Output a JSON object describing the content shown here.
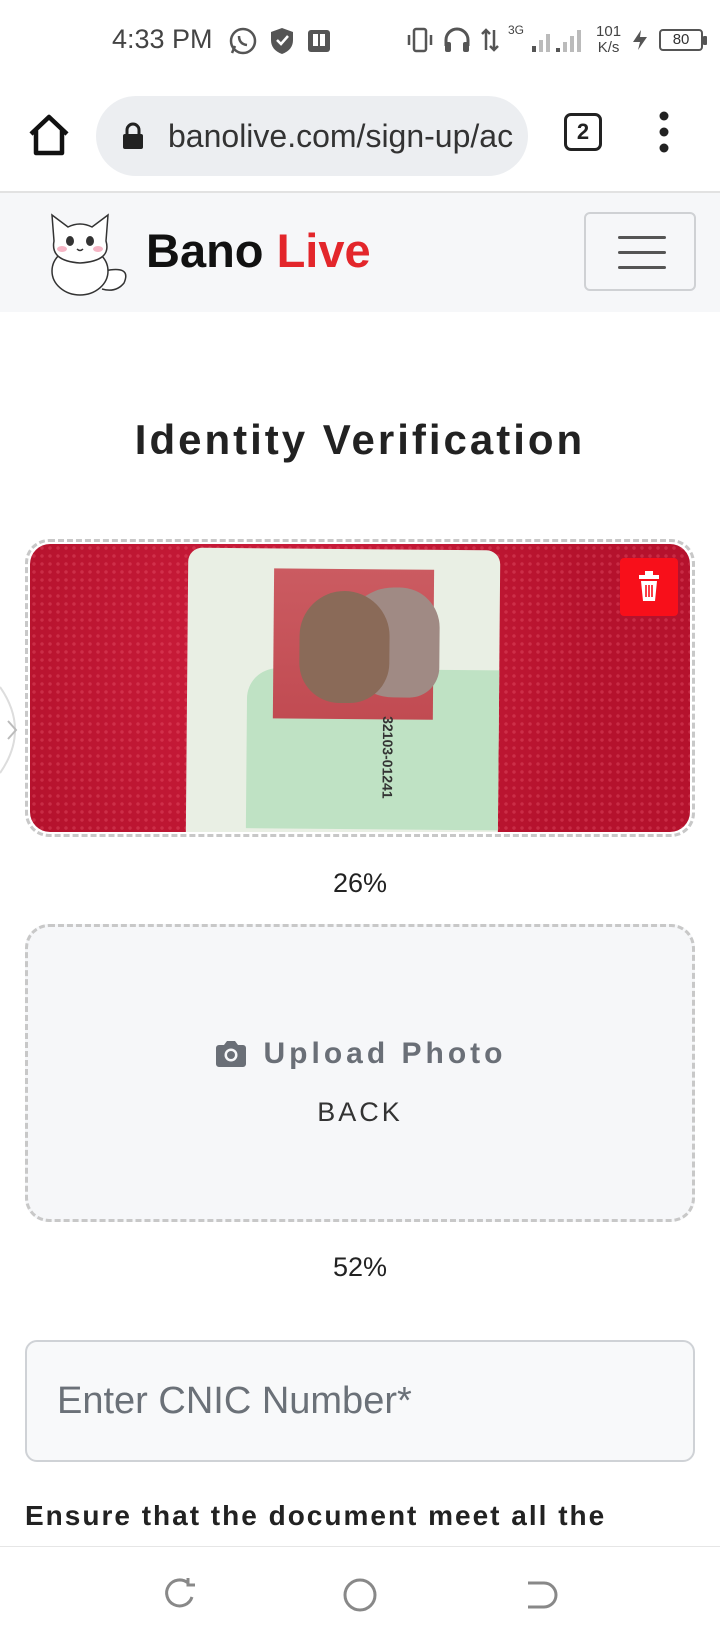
{
  "status_bar": {
    "time": "4:33 PM",
    "network_gen": "3G",
    "net_speed_value": "101",
    "net_speed_unit": "K/s",
    "battery": "80"
  },
  "browser": {
    "url": "banolive.com/sign-up/ac",
    "tab_count": "2"
  },
  "site": {
    "brand_part1": "Bano",
    "brand_part2": "Live",
    "accent_color": "#e3262b"
  },
  "page": {
    "title": "Identity Verification",
    "front_upload": {
      "progress_text": "26%",
      "progress": 0.26
    },
    "back_upload": {
      "label": "Upload Photo",
      "side": "BACK",
      "progress_text": "52%",
      "progress": 0.52
    },
    "cnic_placeholder": "Enter CNIC Number*",
    "note": "Ensure that the document meet all the"
  },
  "icons": [
    "home-icon",
    "lock-icon",
    "more-vert-icon",
    "trash-icon",
    "camera-icon",
    "recents-icon",
    "home-circle-icon",
    "back-icon"
  ]
}
